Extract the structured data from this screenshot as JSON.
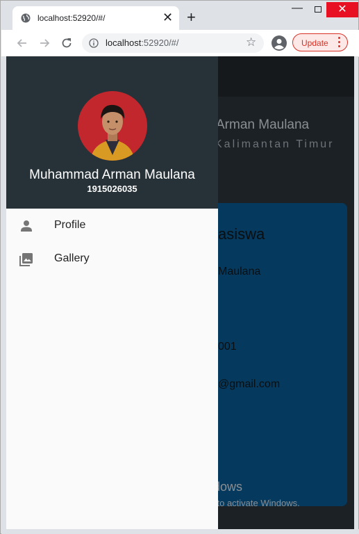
{
  "browser": {
    "tab_title": "localhost:52920/#/",
    "url_host": "localhost",
    "url_rest": ":52920/#/",
    "update_label": "Update",
    "icons": [
      "globe-icon",
      "close-icon",
      "plus-icon",
      "back-icon",
      "forward-icon",
      "reload-icon",
      "info-icon",
      "star-icon",
      "profile-icon",
      "kebab-menu-icon"
    ]
  },
  "background": {
    "name": "Arman Maulana",
    "subtitle": "Kalimantan Timur",
    "card_title": "asiswa",
    "card_lines": [
      "Maulana",
      "001",
      "@gmail.com"
    ]
  },
  "drawer": {
    "name": "Muhammad Arman Maulana",
    "student_id": "1915026035",
    "items": [
      {
        "label": "Profile",
        "icon": "person-icon"
      },
      {
        "label": "Gallery",
        "icon": "photo-library-icon"
      }
    ]
  },
  "watermark": {
    "title": "Activate Windows",
    "subtitle": "Go to PC settings to activate Windows."
  },
  "colors": {
    "drawer_header": "#263238",
    "card": "#053a5e",
    "app_bg": "#1b2125",
    "update_accent": "#d93025"
  }
}
